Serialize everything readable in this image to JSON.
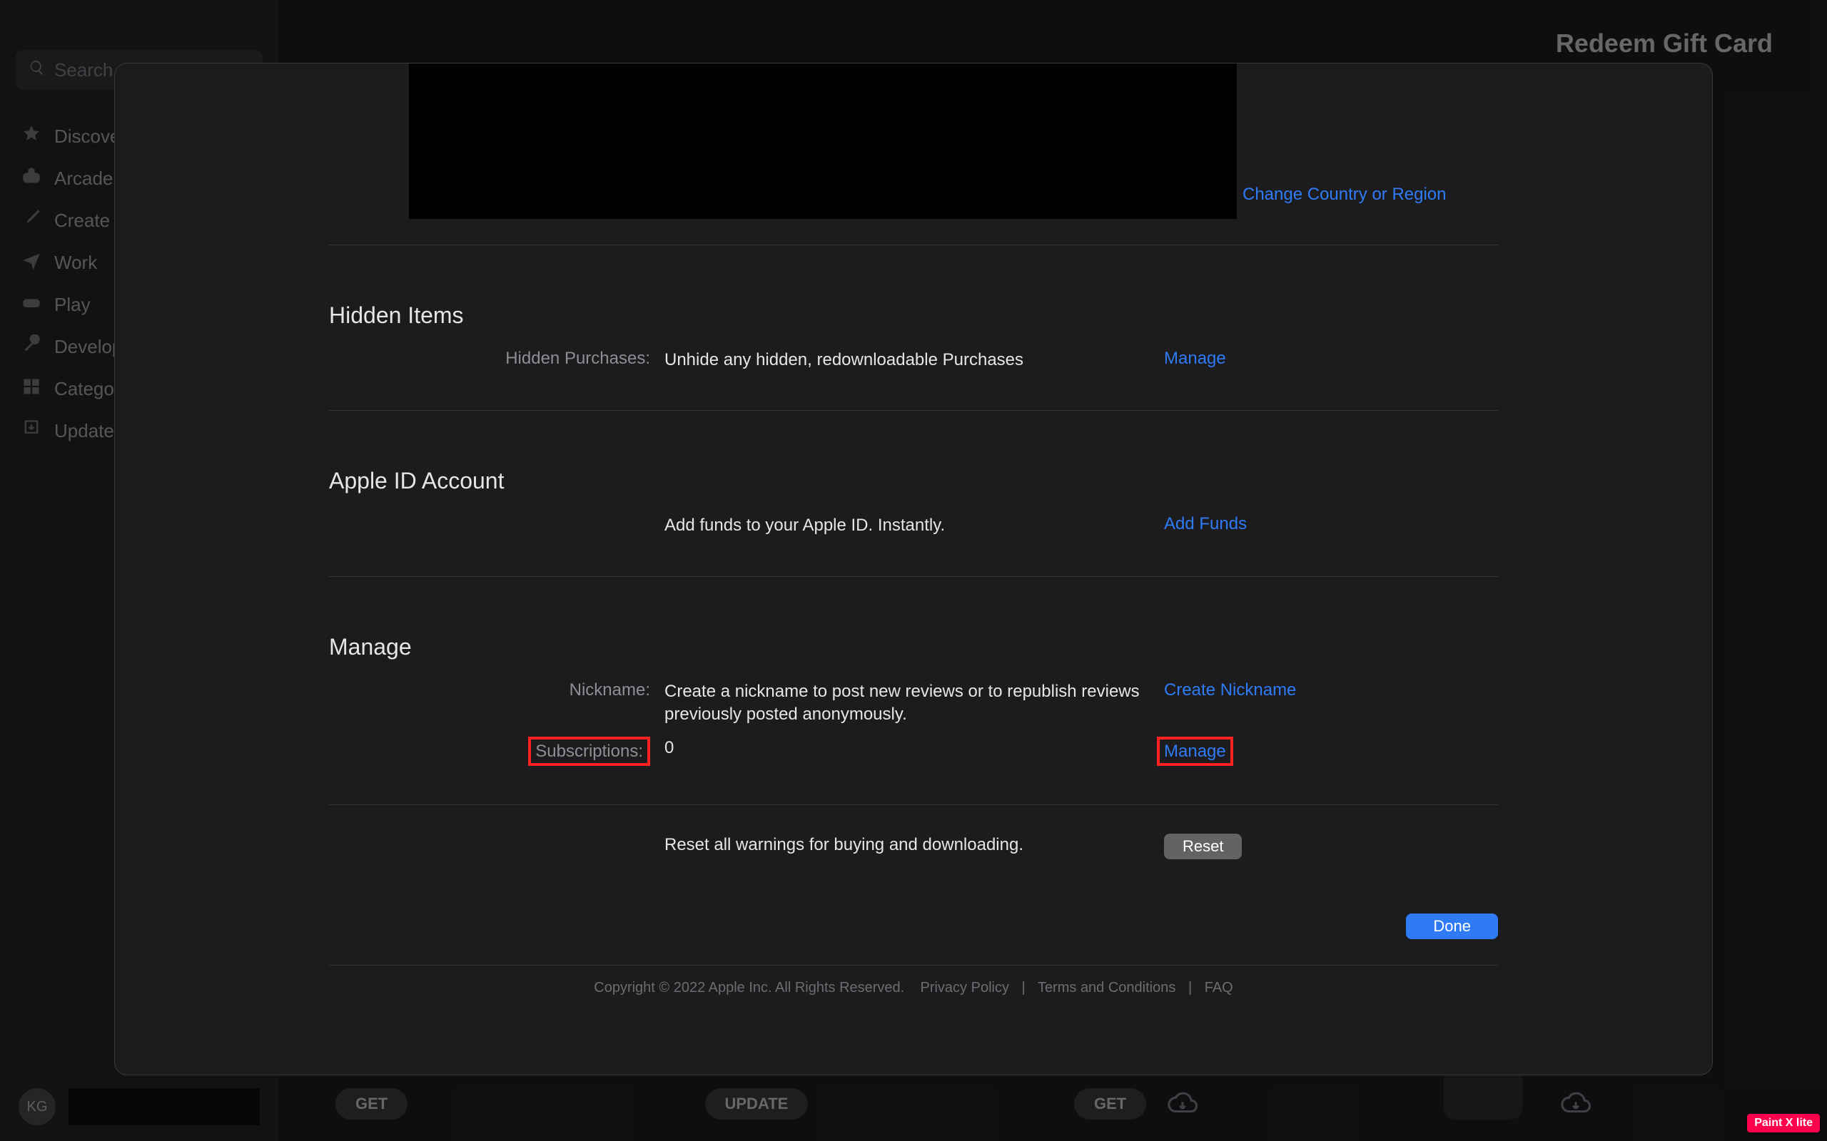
{
  "sidebar": {
    "search_placeholder": "Search",
    "items": [
      {
        "icon": "star-icon",
        "label": "Discover"
      },
      {
        "icon": "game-icon",
        "label": "Arcade"
      },
      {
        "icon": "brush-icon",
        "label": "Create"
      },
      {
        "icon": "plane-icon",
        "label": "Work"
      },
      {
        "icon": "controller-icon",
        "label": "Play"
      },
      {
        "icon": "wrench-icon",
        "label": "Develop"
      },
      {
        "icon": "grid-icon",
        "label": "Categories"
      },
      {
        "icon": "download-icon",
        "label": "Updates"
      }
    ],
    "avatar_initials": "KG"
  },
  "main": {
    "toolbar_right": "Redeem Gift Card",
    "bottom": {
      "get_label": "GET",
      "update_label": "UPDATE"
    }
  },
  "sheet": {
    "change_region": "Change Country or Region",
    "hidden": {
      "title": "Hidden Items",
      "label": "Hidden Purchases:",
      "value": "Unhide any hidden, redownloadable Purchases",
      "action": "Manage"
    },
    "account": {
      "title": "Apple ID Account",
      "value": "Add funds to your Apple ID. Instantly.",
      "action": "Add Funds"
    },
    "manage": {
      "title": "Manage",
      "nickname_label": "Nickname:",
      "nickname_value": "Create a nickname to post new reviews or to republish reviews previously posted anonymously.",
      "nickname_action": "Create Nickname",
      "subs_label": "Subscriptions:",
      "subs_value": "0",
      "subs_action": "Manage"
    },
    "reset": {
      "value": "Reset all warnings for buying and downloading.",
      "button": "Reset"
    },
    "done": "Done",
    "footer": {
      "copyright": "Copyright © 2022 Apple Inc. All Rights Reserved.",
      "privacy": "Privacy Policy",
      "terms": "Terms and Conditions",
      "faq": "FAQ"
    }
  },
  "annotation": "Paint X lite"
}
